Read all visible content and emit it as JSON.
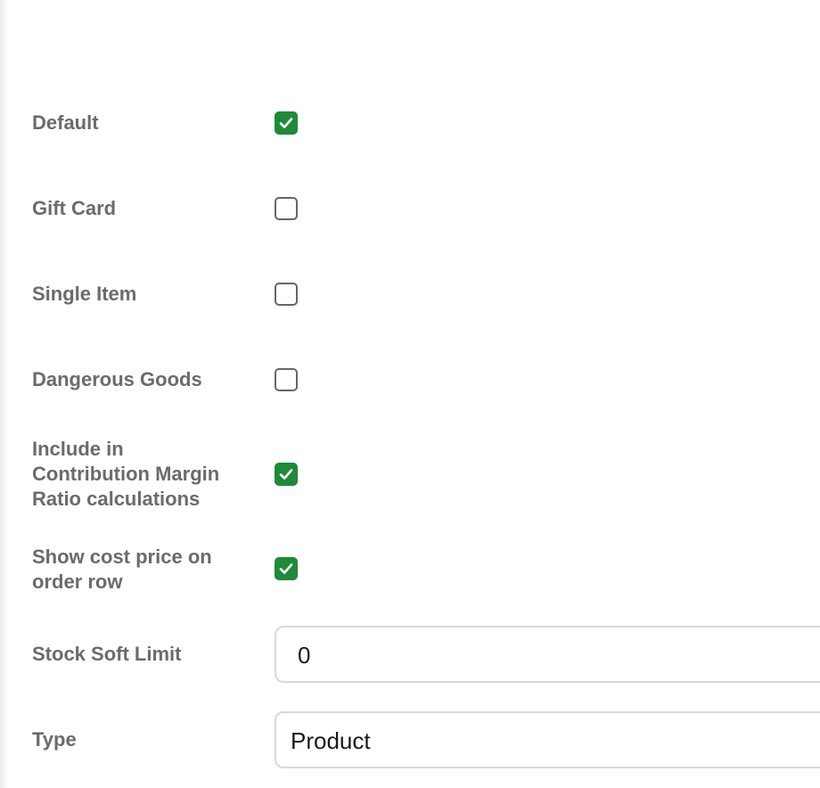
{
  "fields": {
    "default": {
      "label": "Default",
      "checked": true
    },
    "gift_card": {
      "label": "Gift Card",
      "checked": false
    },
    "single_item": {
      "label": "Single Item",
      "checked": false
    },
    "dangerous_goods": {
      "label": "Dangerous Goods",
      "checked": false
    },
    "include_cmr": {
      "label_lines": [
        "Include in",
        "Contribution Margin",
        "Ratio calculations"
      ],
      "checked": true
    },
    "show_cost_price": {
      "label_lines": [
        "Show cost price on",
        "order row"
      ],
      "checked": true
    },
    "stock_soft_limit": {
      "label": "Stock Soft Limit",
      "value": "0"
    },
    "type": {
      "label": "Type",
      "value": "Product"
    }
  },
  "colors": {
    "checked_fill": "#1e8a3a",
    "label_text": "#6b6b6b",
    "input_border": "#d9d9d9"
  },
  "icons": {
    "checked": "checkmark-icon"
  }
}
